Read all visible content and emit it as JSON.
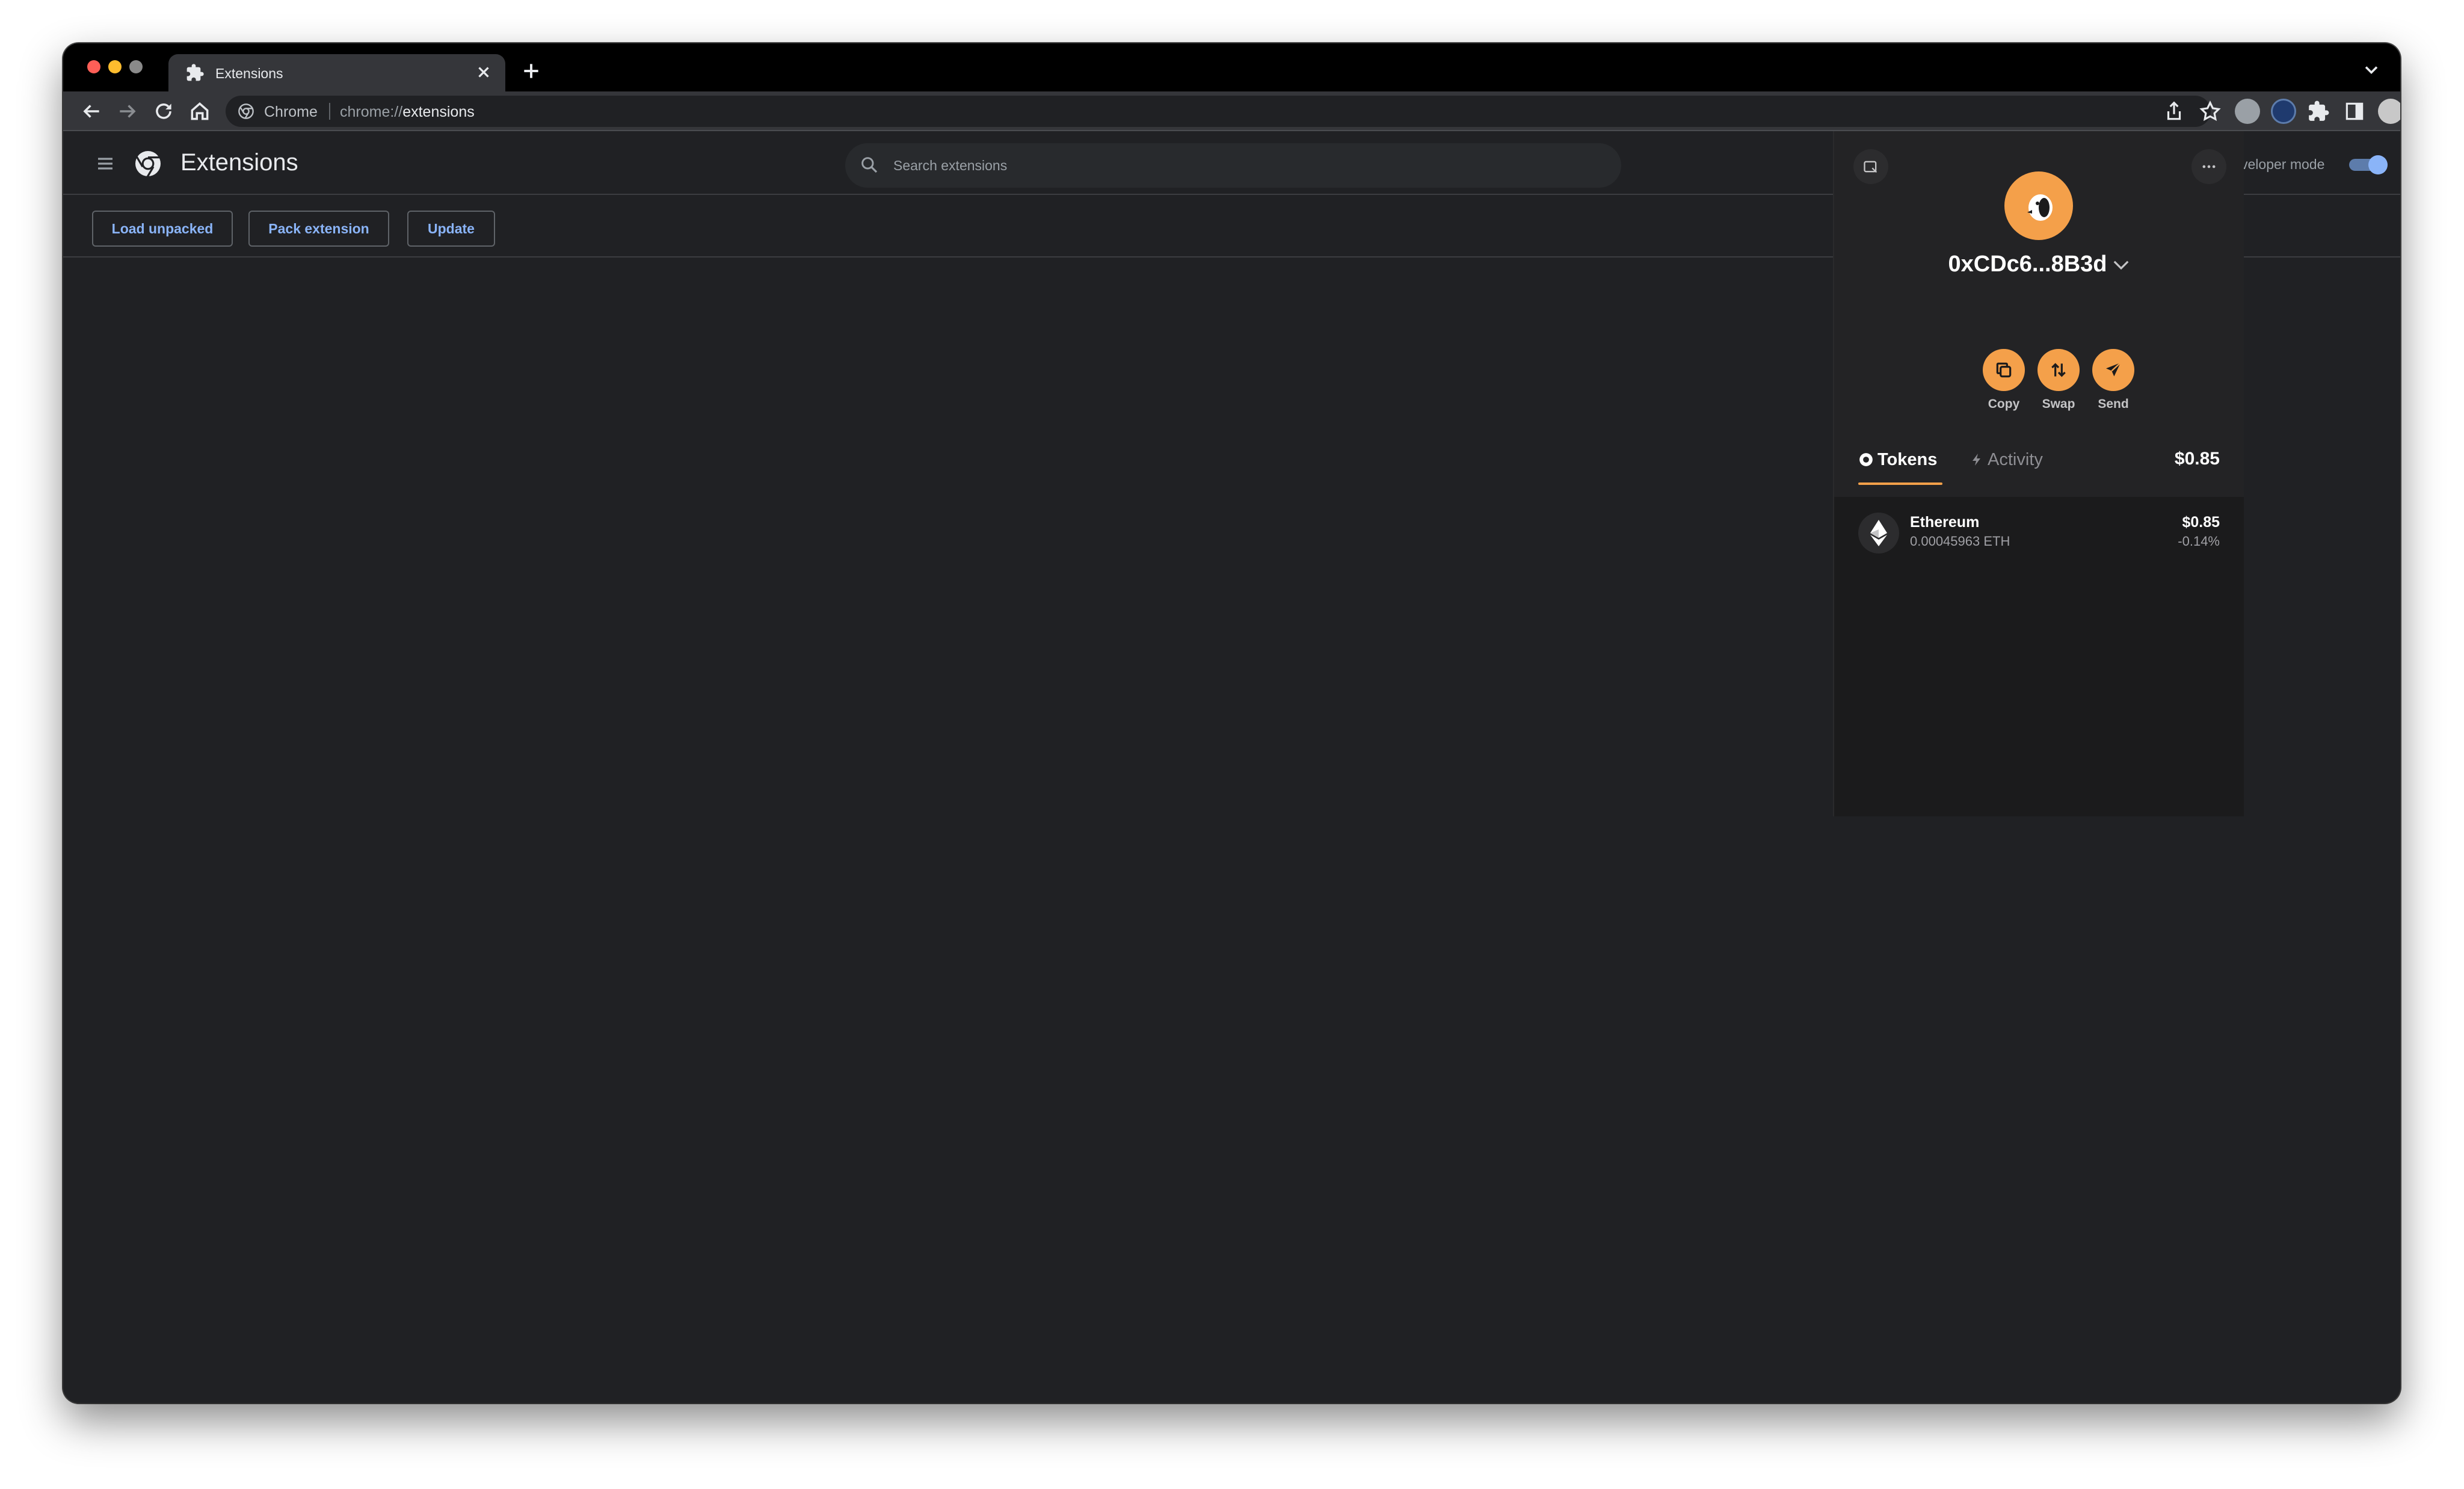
{
  "browser": {
    "tab_title": "Extensions",
    "omnibox_site": "Chrome",
    "omnibox_url_scheme": "chrome://",
    "omnibox_url_path": "extensions"
  },
  "extensions_page": {
    "title": "Extensions",
    "search_placeholder": "Search extensions",
    "developer_mode_label": "veloper mode",
    "developer_mode_on": true,
    "buttons": {
      "load_unpacked": "Load unpacked",
      "pack_extension": "Pack extension",
      "update": "Update"
    }
  },
  "wallet": {
    "address": "0xCDc6...8B3d",
    "actions": {
      "copy": "Copy",
      "swap": "Swap",
      "send": "Send"
    },
    "tabs": {
      "tokens": "Tokens",
      "activity": "Activity"
    },
    "total_balance": "$0.85",
    "tokens": [
      {
        "name": "Ethereum",
        "amount": "0.00045963 ETH",
        "value": "$0.85",
        "change": "-0.14%"
      }
    ],
    "accent_color": "#f4a04a"
  }
}
